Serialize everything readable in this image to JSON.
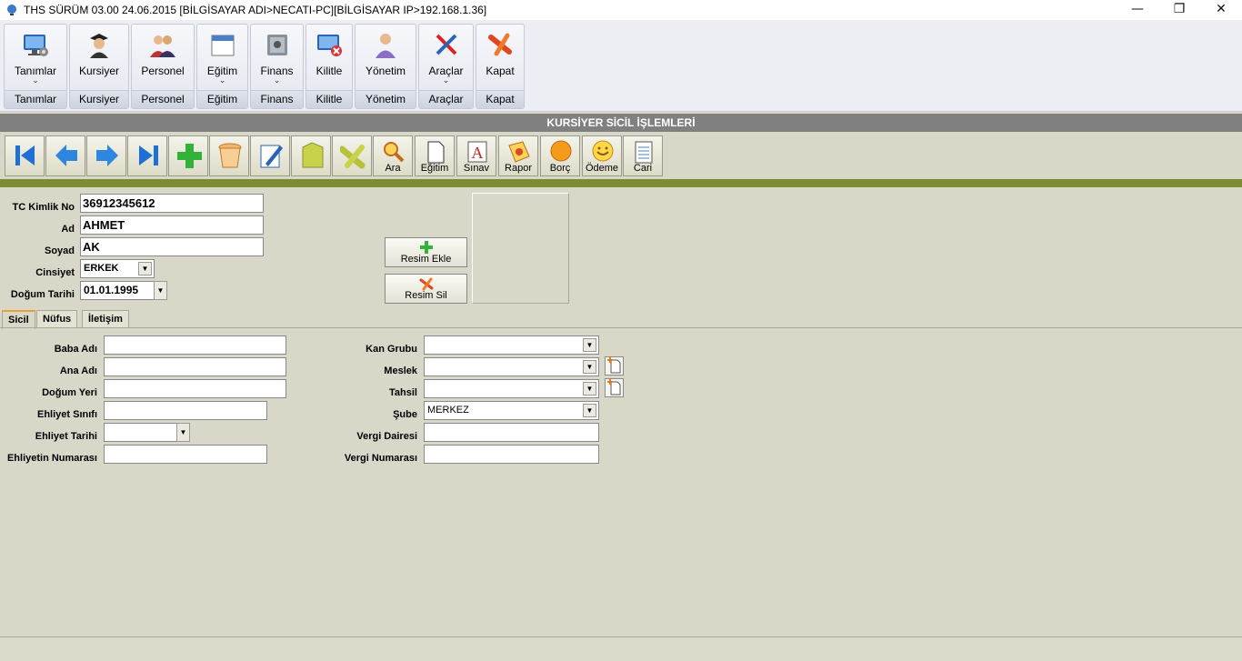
{
  "window": {
    "title": "THS SÜRÜM 03.00 24.06.2015 [BİLGİSAYAR ADI>NECATI-PC][BİLGİSAYAR IP>192.168.1.36]",
    "minimize": "—",
    "restore": "❐",
    "close": "✕"
  },
  "ribbon": {
    "groups": [
      {
        "label": "Tanımlar",
        "group": "Tanımlar",
        "chevron": "⌄"
      },
      {
        "label": "Kursiyer",
        "group": "Kursiyer",
        "chevron": ""
      },
      {
        "label": "Personel",
        "group": "Personel",
        "chevron": ""
      },
      {
        "label": "Eğitim",
        "group": "Eğitim",
        "chevron": "⌄"
      },
      {
        "label": "Finans",
        "group": "Finans",
        "chevron": "⌄"
      },
      {
        "label": "Kilitle",
        "group": "Kilitle",
        "chevron": ""
      },
      {
        "label": "Yönetim",
        "group": "Yönetim",
        "chevron": ""
      },
      {
        "label": "Araçlar",
        "group": "Araçlar",
        "chevron": "⌄"
      },
      {
        "label": "Kapat",
        "group": "Kapat",
        "chevron": ""
      }
    ]
  },
  "page_title": "KURSİYER SİCİL İŞLEMLERİ",
  "toolbar": {
    "buttons": [
      {
        "icon": "first-record-icon",
        "label": ""
      },
      {
        "icon": "previous-record-icon",
        "label": ""
      },
      {
        "icon": "next-record-icon",
        "label": ""
      },
      {
        "icon": "last-record-icon",
        "label": ""
      },
      {
        "icon": "add-icon",
        "label": ""
      },
      {
        "icon": "delete-bucket-icon",
        "label": ""
      },
      {
        "icon": "edit-icon",
        "label": ""
      },
      {
        "icon": "save-icon",
        "label": ""
      },
      {
        "icon": "cancel-icon",
        "label": ""
      },
      {
        "icon": "search-icon",
        "label": "Ara"
      },
      {
        "icon": "document-icon",
        "label": "Eğitim"
      },
      {
        "icon": "exam-icon",
        "label": "Sınav"
      },
      {
        "icon": "report-icon",
        "label": "Rapor"
      },
      {
        "icon": "debt-icon",
        "label": "Borç"
      },
      {
        "icon": "payment-icon",
        "label": "Ödeme"
      },
      {
        "icon": "account-icon",
        "label": "Cari"
      }
    ]
  },
  "form": {
    "tc_label": "TC Kimlik No",
    "tc_value": "36912345612",
    "ad_label": "Ad",
    "ad_value": "AHMET",
    "soyad_label": "Soyad",
    "soyad_value": "AK",
    "cinsiyet_label": "Cinsiyet",
    "cinsiyet_value": "ERKEK",
    "dogum_label": "Doğum Tarihi",
    "dogum_value": "01.01.1995",
    "resim_ekle": "Resim Ekle",
    "resim_sil": "Resim Sil"
  },
  "tabs": [
    {
      "label": "Sicil",
      "active": true
    },
    {
      "label": "Nüfus",
      "active": false
    },
    {
      "label": "İletişim",
      "active": false
    }
  ],
  "sicil": {
    "baba_adi": "Baba Adı",
    "ana_adi": "Ana Adı",
    "dogum_yeri": "Doğum Yeri",
    "ehliyet_sinifi": "Ehliyet Sınıfı",
    "ehliyet_tarihi": "Ehliyet Tarihi",
    "ehliyet_numarasi": "Ehliyetin Numarası",
    "kan_grubu": "Kan Grubu",
    "meslek": "Meslek",
    "tahsil": "Tahsil",
    "sube": "Şube",
    "sube_value": "MERKEZ",
    "vergi_dairesi": "Vergi Dairesi",
    "vergi_numarasi": "Vergi Numarası"
  },
  "colors": {
    "header_bg": "#808080",
    "accent_green": "#7c8c33",
    "body_bg": "#d9d8c8"
  }
}
